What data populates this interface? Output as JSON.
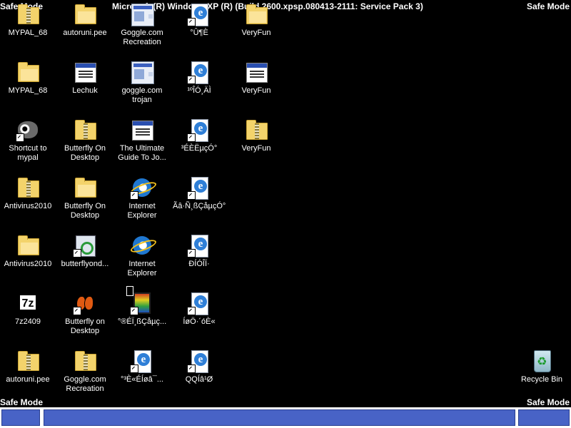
{
  "safe_mode_label": "Safe Mode",
  "build_text": "Microsoft (R) Windows XP (R) (Build 2600.xpsp.080413-2111: Service Pack 3)",
  "icons": {
    "c1r1": "MYPAL_68",
    "c2r1": "autoruni.pee",
    "c3r1": "Goggle.com\nRecreation",
    "c4r1": "°Û¶È",
    "c5r1": "VeryFun",
    "c1r2": "MYPAL_68",
    "c2r2": "Lechuk",
    "c3r2": "goggle.com\ntrojan",
    "c4r2": "¹ºÎÓ¸ÄÌ",
    "c5r2": "VeryFun",
    "c1r3": "Shortcut to\nmypal",
    "c2r3": "Butterfly On\nDesktop",
    "c3r3": "The Ultimate\nGuide To Jo...",
    "c4r3": "³ÉÈËµçÓ°",
    "c5r3": "VeryFun",
    "c1r4": "Antivirus2010",
    "c2r4": "Butterfly On\nDesktop",
    "c3r4": "Internet\nExplorer",
    "c4r4": "Ãâ·Ñ¸ßÇåµçÓ°",
    "c1r5": "Antivirus2010",
    "c2r5": "butterflyond...",
    "c3r5": "Internet\nExplorer",
    "c4r5": "ÐÍÓÎÏ·",
    "c1r6": "7z2409",
    "c2r6": "Butterfly on\nDesktop",
    "c3r6": "°®ÉÏ¸ßÇåµç...",
    "c4r6": "ÍøÖ·´óÈ«",
    "c1r7": "autoruni.pee",
    "c2r7": "Goggle.com\nRecreation",
    "c3r7": "°³È«ÉÍøâ¯...",
    "c4r7": "QQÍâ¹Ø",
    "recycle_bin": "Recycle Bin"
  },
  "icon_types": {
    "folder": "folder-icon",
    "zip": "zip-folder-icon",
    "window": "application-window-icon",
    "ie": "internet-explorer-icon",
    "html": "html-document-icon",
    "recycle": "recycle-bin-icon"
  },
  "colors": {
    "desktop": "#000000",
    "taskbar_segment": "#4863c6",
    "taskbar_bg": "#ffffff"
  }
}
